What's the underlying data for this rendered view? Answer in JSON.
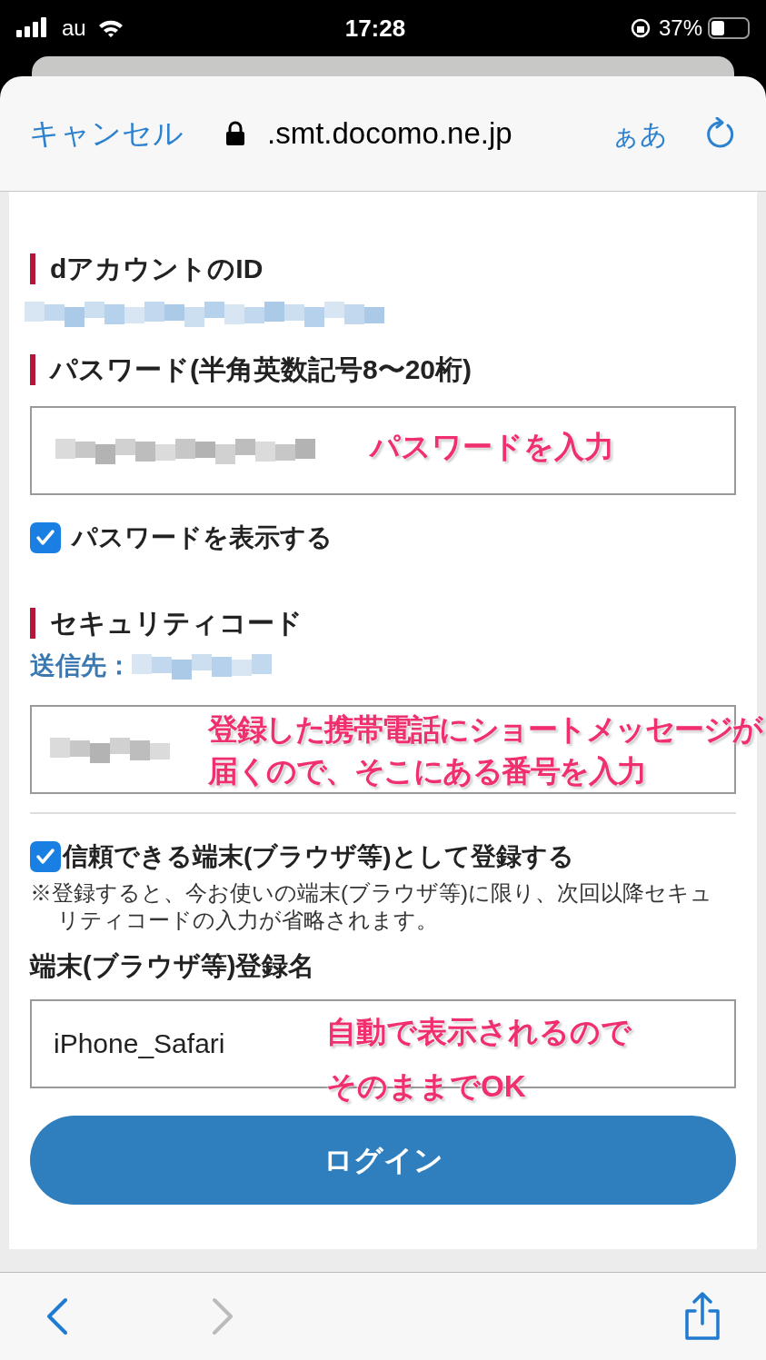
{
  "status_bar": {
    "carrier": "au",
    "time": "17:28",
    "battery": "37%"
  },
  "header": {
    "cancel": "キャンセル",
    "domain": ".smt.docomo.ne.jp",
    "text_size": "ぁあ"
  },
  "form": {
    "id_heading": "dアカウントのID",
    "password_heading": "パスワード(半角英数記号8〜20桁)",
    "password_note": "パスワードを入力",
    "show_password": {
      "label": "パスワードを表示する",
      "checked": true
    },
    "security_heading": "セキュリティコード",
    "send_to_label": "送信先：",
    "security_note": [
      "登録した携帯電話にショートメッセージが",
      "届くので、そこにある番号を入力"
    ],
    "trust_device": {
      "label": "信頼できる端末(ブラウザ等)として登録する",
      "checked": true
    },
    "trust_note": "※登録すると、今お使いの端末(ブラウザ等)に限り、次回以降セキュリティコードの入力が省略されます。",
    "device_name_label": "端末(ブラウザ等)登録名",
    "device_name_value": "iPhone_Safari",
    "device_note": [
      "自動で表示されるので",
      "そのままでOK"
    ],
    "login_button": "ログイン"
  },
  "toolbar": {
    "back_disabled": false,
    "forward_disabled": true
  }
}
